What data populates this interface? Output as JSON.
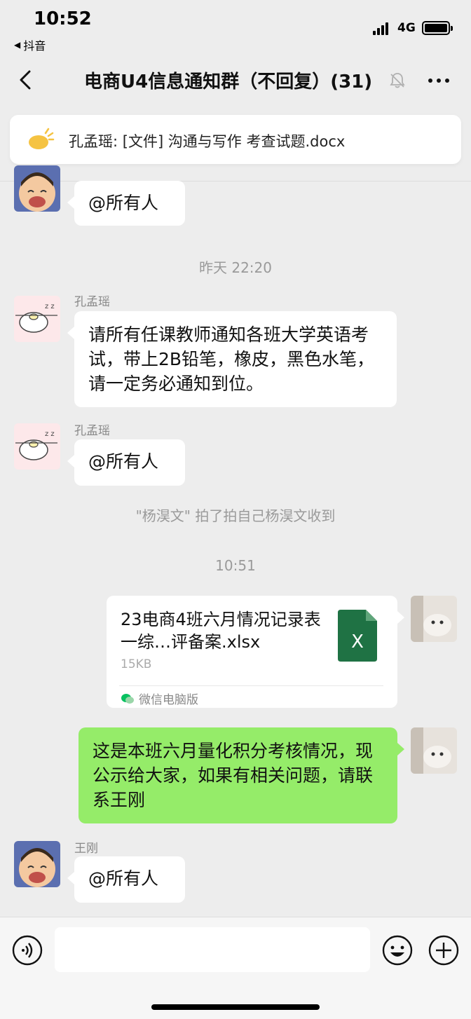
{
  "status_bar": {
    "time": "10:52",
    "back_app": "抖音",
    "network": "4G"
  },
  "nav": {
    "title": "电商U4信息通知群（不回复）(31)"
  },
  "notice": {
    "text": "孔孟瑶: [文件] 沟通与写作 考查试题.docx"
  },
  "messages": {
    "m0": {
      "text": "@所有人"
    },
    "time1": "昨天 22:20",
    "m1": {
      "sender": "孔孟瑶",
      "text": "请所有任课教师通知各班大学英语考试，带上2B铅笔，橡皮，黑色水笔，请一定务必通知到位。"
    },
    "m2": {
      "sender": "孔孟瑶",
      "text": "@所有人"
    },
    "system1": "\"杨淏文\" 拍了拍自己杨淏文收到",
    "time2": "10:51",
    "file": {
      "name": "23电商4班六月情况记录表一综…评备案.xlsx",
      "size": "15KB",
      "icon_letter": "X",
      "source": "微信电脑版"
    },
    "m3": {
      "text": "这是本班六月量化积分考核情况，现公示给大家，如果有相关问题，请联系王刚"
    },
    "m4": {
      "sender": "王刚",
      "text": "@所有人"
    }
  },
  "input": {
    "placeholder": ""
  },
  "colors": {
    "chat_bg": "#ededed",
    "green_bubble": "#95ec69",
    "excel_green": "#1f7244"
  }
}
